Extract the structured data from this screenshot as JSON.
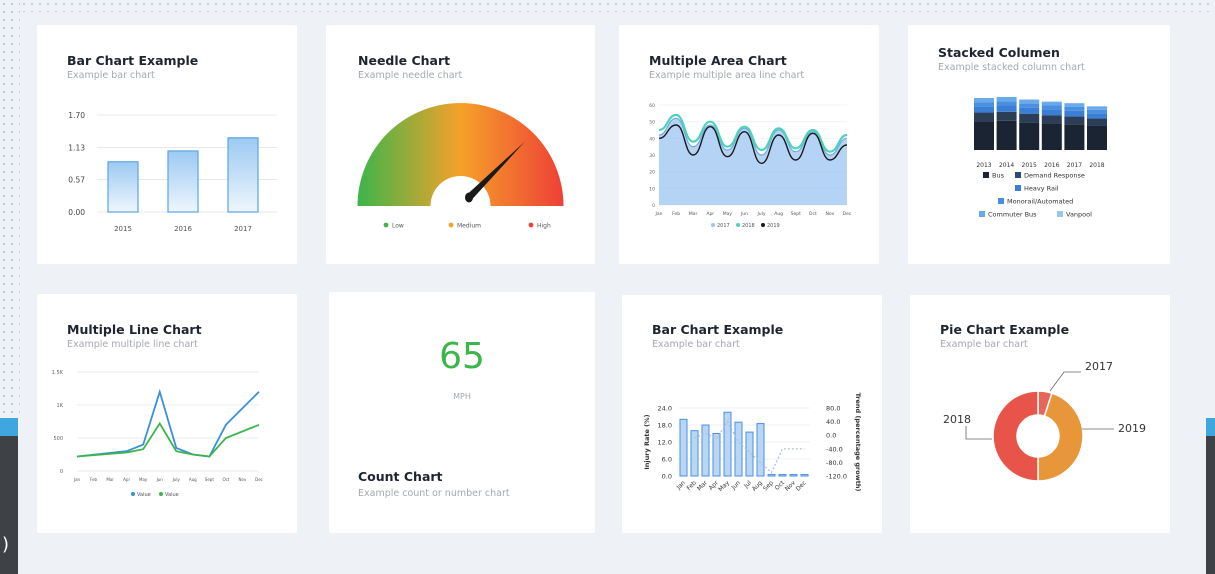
{
  "cards": [
    {
      "title": "Bar Chart Example",
      "subtitle": "Example bar chart"
    },
    {
      "title": "Needle Chart",
      "subtitle": "Example needle chart"
    },
    {
      "title": "Multiple Area Chart",
      "subtitle": "Example multiple area line chart"
    },
    {
      "title": "Stacked Columen",
      "subtitle": "Example stacked column chart"
    },
    {
      "title": "Multiple Line Chart",
      "subtitle": "Example multiple line chart"
    },
    {
      "title": "Count Chart",
      "subtitle": "Example count or number chart"
    },
    {
      "title": "Bar Chart Example",
      "subtitle": "Example bar chart"
    },
    {
      "title": "Pie Chart Example",
      "subtitle": "Example bar chart"
    }
  ],
  "count": {
    "value": "65",
    "unit": "MPH"
  },
  "side_glyph": ")",
  "chart_data": [
    {
      "type": "bar",
      "categories": [
        "2015",
        "2016",
        "2017"
      ],
      "values": [
        0.88,
        1.07,
        1.3
      ],
      "yticks": [
        "0.00",
        "0.57",
        "1.13",
        "1.70"
      ],
      "ylim": [
        0,
        1.7
      ],
      "color": "#5aa5e6"
    },
    {
      "type": "gauge",
      "value": 0.75,
      "legend": [
        {
          "name": "Low",
          "color": "#3cb54a"
        },
        {
          "name": "Medium",
          "color": "#f5a12a"
        },
        {
          "name": "High",
          "color": "#ee4036"
        }
      ]
    },
    {
      "type": "area",
      "categories": [
        "Jan",
        "Feb",
        "Mar",
        "Apr",
        "May",
        "Jun",
        "July",
        "Aug",
        "Sept",
        "Oct",
        "Nov",
        "Dec"
      ],
      "yticks": [
        "0",
        "10",
        "20",
        "30",
        "40",
        "50",
        "60"
      ],
      "ylim": [
        0,
        60
      ],
      "series": [
        {
          "name": "2017",
          "color": "#9cc4f2",
          "values": [
            42,
            52,
            35,
            48,
            33,
            46,
            30,
            45,
            32,
            44,
            30,
            40
          ]
        },
        {
          "name": "2018",
          "color": "#4fd3b8",
          "values": [
            45,
            54,
            38,
            50,
            35,
            47,
            33,
            46,
            34,
            45,
            32,
            42
          ]
        },
        {
          "name": "2019",
          "color": "#1a1a1a",
          "values": [
            40,
            48,
            30,
            47,
            29,
            44,
            25,
            42,
            27,
            43,
            27,
            36
          ]
        }
      ]
    },
    {
      "type": "bar",
      "stacked": true,
      "categories": [
        "2013",
        "2014",
        "2015",
        "2016",
        "2017",
        "2018"
      ],
      "totals": [
        100,
        102,
        97,
        93,
        90,
        84
      ],
      "legend_rows": [
        [
          {
            "name": "Bus",
            "color": "#1b2433"
          },
          {
            "name": "Demand Response",
            "color": "#2f4c78"
          }
        ],
        [
          {
            "name": "Heavy Rail",
            "color": "#3a7fd5"
          }
        ],
        [
          {
            "name": "Monorail/Automated",
            "color": "#4a90e2"
          }
        ],
        [
          {
            "name": "Commuter Bus",
            "color": "#6aa9ec"
          },
          {
            "name": "Vanpool",
            "color": "#9ac6f2"
          }
        ]
      ]
    },
    {
      "type": "line",
      "categories": [
        "Jan",
        "Feb",
        "Mar",
        "Apr",
        "May",
        "Jun",
        "July",
        "Aug",
        "Sept",
        "Oct",
        "Nov",
        "Dec"
      ],
      "yticks": [
        "0",
        "500",
        "1K",
        "1.5K"
      ],
      "ylim": [
        0,
        1500
      ],
      "series": [
        {
          "name": "Value",
          "color": "#3a8fd9",
          "values": [
            220,
            300,
            400,
            1200,
            350,
            250,
            220,
            700,
            1200
          ]
        },
        {
          "name": "Value",
          "color": "#3cb54a",
          "values": [
            220,
            280,
            330,
            720,
            300,
            250,
            220,
            500,
            700
          ]
        }
      ]
    },
    {
      "type": "bar",
      "categories": [
        "Jan",
        "Feb",
        "Mar",
        "Apr",
        "May",
        "Jun",
        "Jul",
        "Aug",
        "Sep",
        "Oct",
        "Nov",
        "Dec"
      ],
      "values": [
        20,
        16,
        18,
        15,
        22.5,
        19,
        15.5,
        18.5,
        0.5,
        0.5,
        0.5,
        0.5
      ],
      "trend": [
        null,
        -8,
        5,
        -10,
        40,
        -20,
        null,
        null,
        -110,
        -40,
        -40,
        -40
      ],
      "yticks": [
        "0.0",
        "6.0",
        "12.0",
        "18.0",
        "24.0"
      ],
      "y2ticks": [
        "-120.0",
        "-80.0",
        "-40.0",
        "0.0",
        "40.0",
        "80.0"
      ],
      "ylabel": "Injury Rate (%)",
      "y2label": "Trend (percentage growth)",
      "ylim": [
        0,
        24
      ],
      "y2lim": [
        -120,
        80
      ]
    },
    {
      "type": "pie",
      "slices": [
        {
          "label": "2017",
          "value": 5,
          "color": "#e8655a"
        },
        {
          "label": "2019",
          "value": 45,
          "color": "#e8963a"
        },
        {
          "label": "2018",
          "value": 50,
          "color": "#e8544a"
        }
      ]
    }
  ]
}
